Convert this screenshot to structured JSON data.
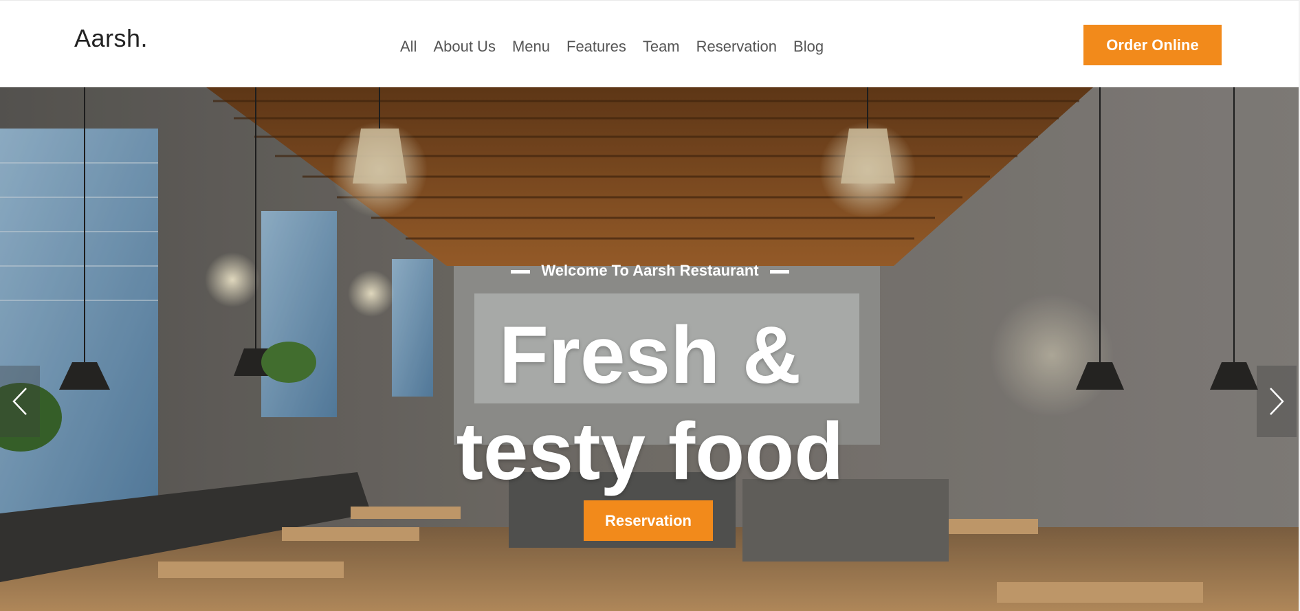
{
  "header": {
    "logo": "Aarsh.",
    "nav": [
      "All",
      "About Us",
      "Menu",
      "Features",
      "Team",
      "Reservation",
      "Blog"
    ],
    "order_button": "Order Online"
  },
  "hero": {
    "welcome": "Welcome To Aarsh Restaurant",
    "headline_line1": "Fresh &",
    "headline_line2": "testy food",
    "reservation_button": "Reservation",
    "prev_icon": "chevron-left-icon",
    "next_icon": "chevron-right-icon"
  },
  "colors": {
    "accent": "#f28a1b",
    "text_dark": "#222222",
    "nav_text": "#555555"
  }
}
